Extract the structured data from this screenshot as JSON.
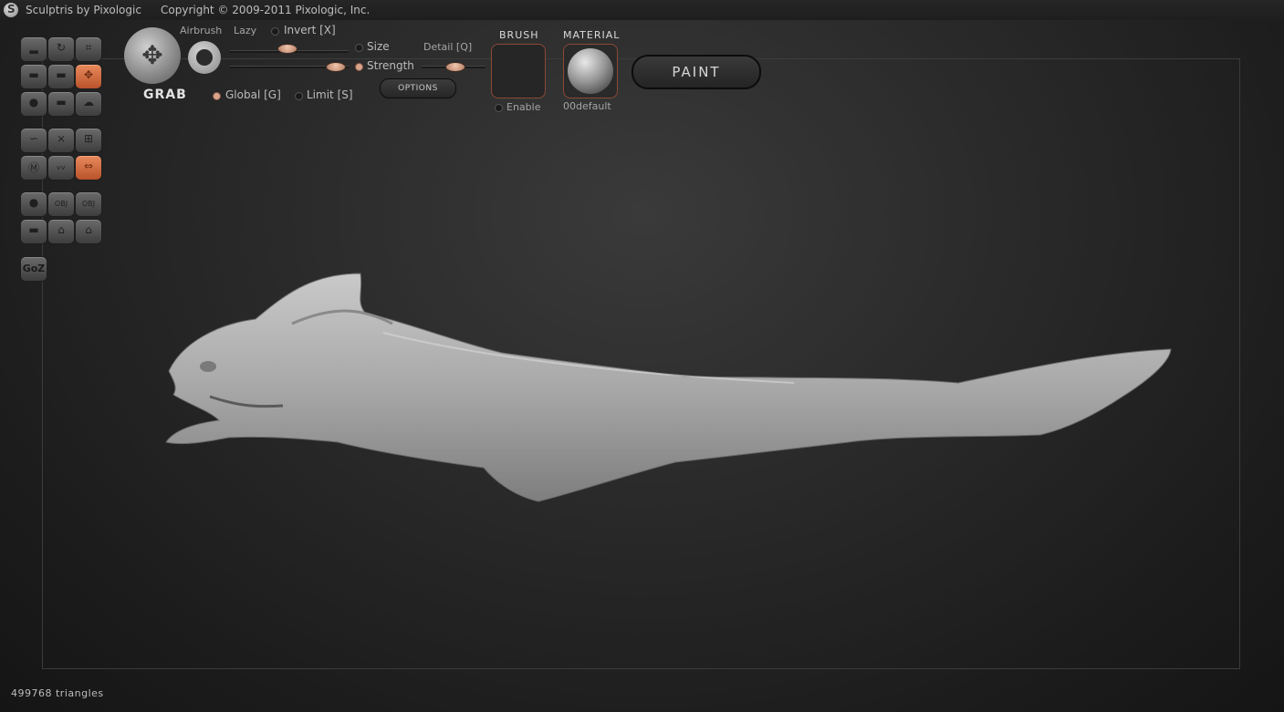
{
  "title_bar": {
    "app_name": "Sculptris by Pixologic",
    "copyright": "Copyright © 2009-2011 Pixologic, Inc."
  },
  "left_tools": [
    {
      "icon": "flatten-tool-icon",
      "glyph": "▂",
      "active": false
    },
    {
      "icon": "rotate-tool-icon",
      "glyph": "↻",
      "active": false
    },
    {
      "icon": "crop-tool-icon",
      "glyph": "⌗",
      "active": false
    },
    {
      "icon": "draw-tool-icon",
      "glyph": "▬",
      "active": false
    },
    {
      "icon": "inflate-tool-icon",
      "glyph": "▬",
      "active": false
    },
    {
      "icon": "grab-tool-icon",
      "glyph": "✥",
      "active": true
    },
    {
      "icon": "pinch-tool-icon",
      "glyph": "●",
      "active": false
    },
    {
      "icon": "crease-tool-icon",
      "glyph": "▬",
      "active": false
    },
    {
      "icon": "smooth-tool-icon",
      "glyph": "☁",
      "active": false
    },
    {
      "icon": "reduce-brush-icon",
      "glyph": "∽",
      "active": false
    },
    {
      "icon": "reduce-selected-icon",
      "glyph": "⨯",
      "active": false
    },
    {
      "icon": "subdivide-icon",
      "glyph": "⊞",
      "active": false
    },
    {
      "icon": "mask-icon",
      "glyph": "Ⓜ",
      "active": false
    },
    {
      "icon": "wireframe-icon",
      "glyph": "ᵥᵥ",
      "active": false
    },
    {
      "icon": "symmetry-icon",
      "glyph": "⇔",
      "active": true
    },
    {
      "icon": "new-sphere-icon",
      "glyph": "●",
      "active": false
    },
    {
      "icon": "import-obj-icon",
      "glyph": "OBJ",
      "active": false
    },
    {
      "icon": "export-obj-icon",
      "glyph": "OBJ",
      "active": false
    },
    {
      "icon": "new-plane-icon",
      "glyph": "▬",
      "active": false
    },
    {
      "icon": "open-file-icon",
      "glyph": "⌂",
      "active": false
    },
    {
      "icon": "save-file-icon",
      "glyph": "⌂",
      "active": false
    }
  ],
  "goz_label": "GoZ",
  "brush_settings": {
    "tool_name": "GRAB",
    "airbrush_label": "Airbrush",
    "lazy_label": "Lazy",
    "invert_label": "Invert [X]",
    "size_label": "Size",
    "strength_label": "Strength",
    "detail_label": "Detail [Q]",
    "global_label": "Global [G]",
    "limit_label": "Limit [S]",
    "options_label": "OPTIONS"
  },
  "brush_panel": {
    "title": "BRUSH",
    "enable_label": "Enable"
  },
  "material_panel": {
    "title": "MATERIAL",
    "name": "00default"
  },
  "paint_button_label": "PAINT",
  "status": {
    "triangles": "499768 triangles"
  }
}
